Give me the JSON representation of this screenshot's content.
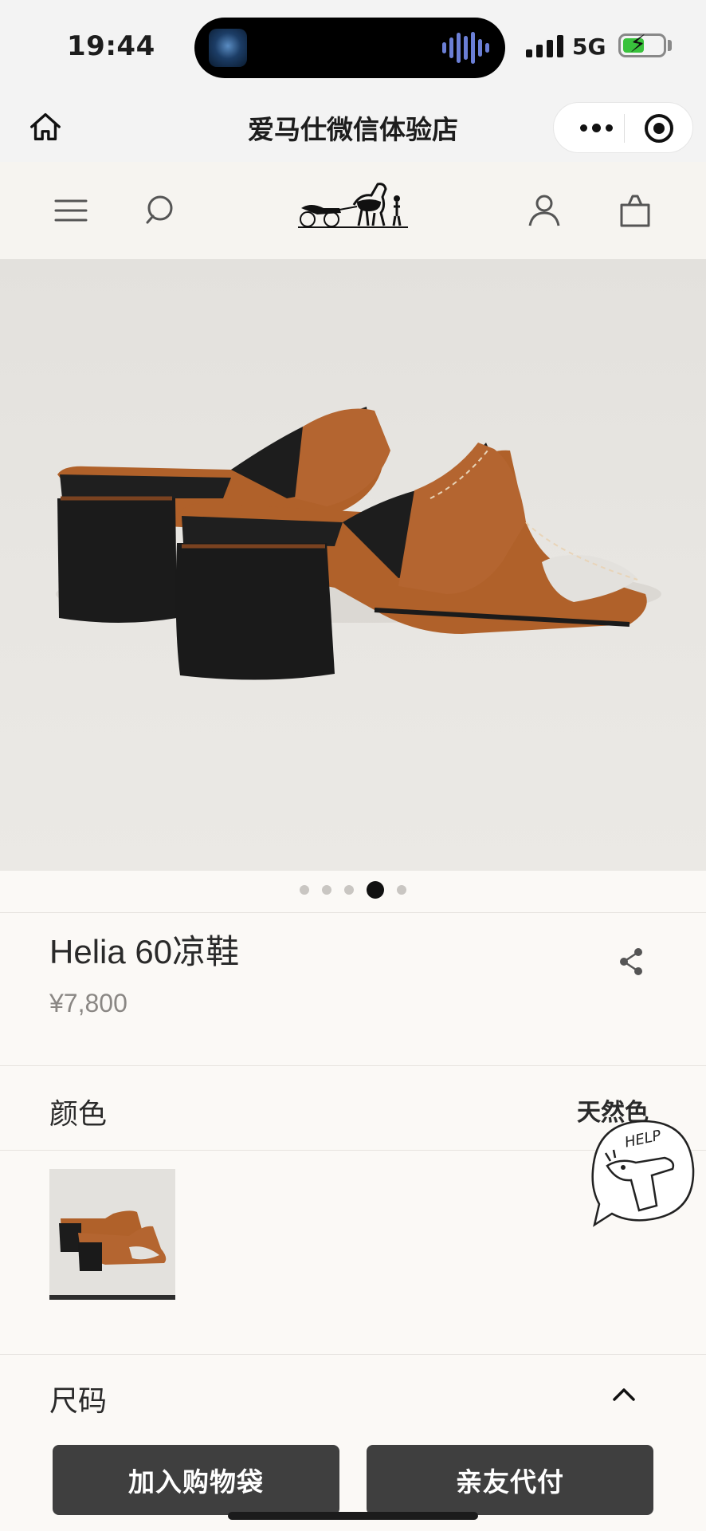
{
  "status_bar": {
    "time": "19:44",
    "network": "5G"
  },
  "mini_program": {
    "title": "爱马仕微信体验店"
  },
  "product": {
    "name": "Helia 60凉鞋",
    "price": "¥7,800",
    "carousel": {
      "count": 5,
      "active_index": 3
    }
  },
  "color_section": {
    "label": "颜色",
    "value": "天然色"
  },
  "size_section": {
    "label": "尺码"
  },
  "actions": {
    "add_to_bag": "加入购物袋",
    "friend_pay": "亲友代付"
  },
  "help_widget": {
    "label": "HELP"
  },
  "colors": {
    "leather": "#b0612a",
    "heel": "#1f1f1f",
    "button": "#3f3f3f",
    "background": "#fbf9f6"
  }
}
